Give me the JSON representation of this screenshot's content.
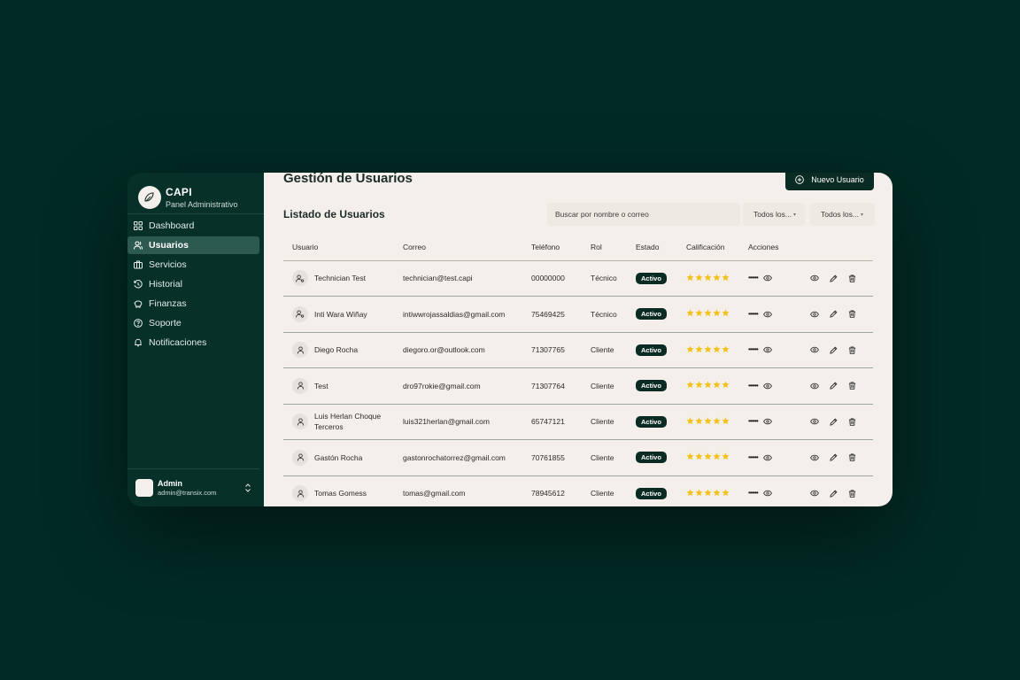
{
  "brand": {
    "name": "CAPI",
    "subtitle": "Panel Administrativo"
  },
  "nav": [
    {
      "label": "Dashboard",
      "icon": "grid-icon",
      "active": false
    },
    {
      "label": "Usuarios",
      "icon": "users-icon",
      "active": true
    },
    {
      "label": "Servicios",
      "icon": "briefcase-icon",
      "active": false
    },
    {
      "label": "Historial",
      "icon": "history-icon",
      "active": false
    },
    {
      "label": "Finanzas",
      "icon": "piggy-bank-icon",
      "active": false
    },
    {
      "label": "Soporte",
      "icon": "help-circle-icon",
      "active": false
    },
    {
      "label": "Notificaciones",
      "icon": "bell-icon",
      "active": false
    }
  ],
  "account": {
    "name": "Admin",
    "email": "admin@transix.com"
  },
  "page": {
    "title": "Gestión de Usuarios",
    "new_button": "Nuevo Usuario",
    "list_title": "Listado de Usuarios",
    "search_placeholder": "Buscar por nombre o correo",
    "filters": [
      "Todos los...",
      "Todos los..."
    ]
  },
  "table": {
    "columns": [
      "Usuario",
      "Correo",
      "Teléfono",
      "Rol",
      "Estado",
      "Calificación",
      "Acciones"
    ],
    "rows": [
      {
        "name": "Technician Test",
        "email": "technician@test.capi",
        "phone": "00000000",
        "role": "Técnico",
        "status": "Activo",
        "rating": 5,
        "masked": "••••••",
        "user_icon": "user-cog-icon"
      },
      {
        "name": "Inti Wara Wiñay",
        "email": "intiwwrojassaldias@gmail.com",
        "phone": "75469425",
        "role": "Técnico",
        "status": "Activo",
        "rating": 5,
        "masked": "••••••",
        "user_icon": "user-cog-icon"
      },
      {
        "name": "Diego Rocha",
        "email": "diegoro.or@outlook.com",
        "phone": "71307765",
        "role": "Cliente",
        "status": "Activo",
        "rating": 5,
        "masked": "••••••",
        "user_icon": "user-icon"
      },
      {
        "name": "Test",
        "email": "dro97rokie@gmail.com",
        "phone": "71307764",
        "role": "Cliente",
        "status": "Activo",
        "rating": 5,
        "masked": "••••••",
        "user_icon": "user-icon"
      },
      {
        "name": "Luis Herlan Choque Terceros",
        "email": "luis321herlan@gmail.com",
        "phone": "65747121",
        "role": "Cliente",
        "status": "Activo",
        "rating": 5,
        "masked": "••••••",
        "user_icon": "user-icon"
      },
      {
        "name": "Gastón Rocha",
        "email": "gastonrochatorrez@gmail.com",
        "phone": "70761855",
        "role": "Cliente",
        "status": "Activo",
        "rating": 5,
        "masked": "••••••",
        "user_icon": "user-icon"
      },
      {
        "name": "Tomas Gomess",
        "email": "tomas@gmail.com",
        "phone": "78945612",
        "role": "Cliente",
        "status": "Activo",
        "rating": 5,
        "masked": "••••••",
        "user_icon": "user-icon"
      }
    ]
  },
  "colors": {
    "sidebar": "#063028",
    "content": "#f4efeb",
    "accent": "#0a2a24",
    "star": "#f2c21b",
    "background": "#022a24"
  }
}
